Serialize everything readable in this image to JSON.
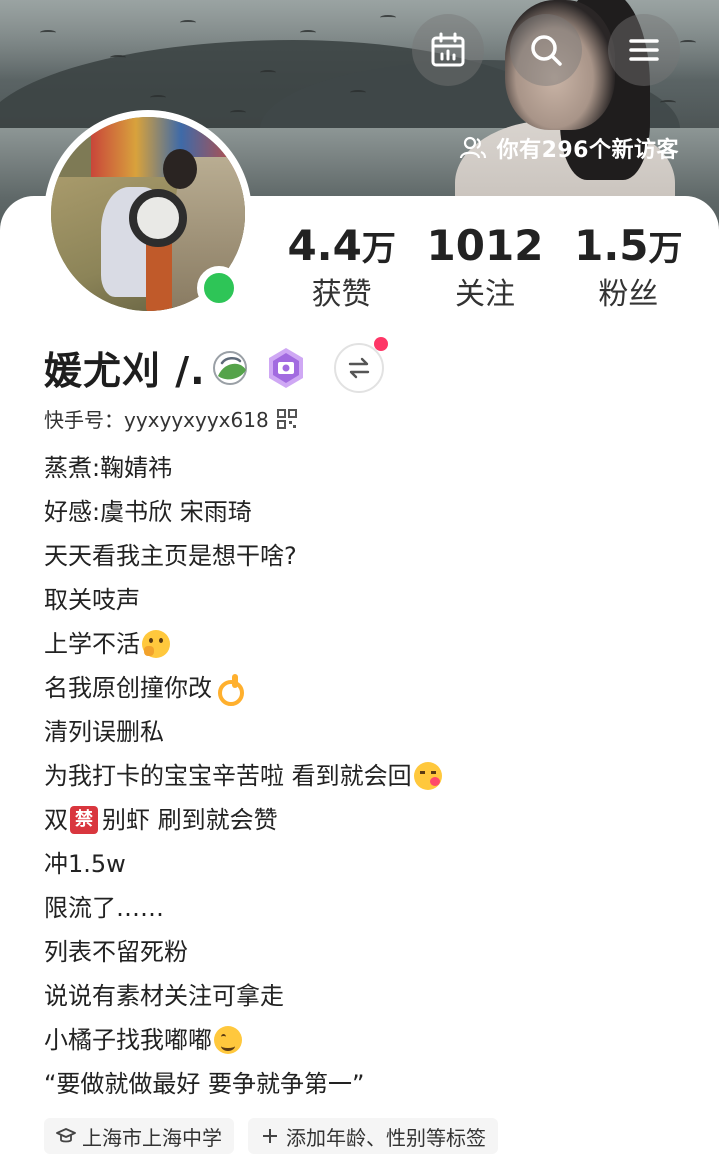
{
  "header": {
    "visitors_text": "你有296个新访客"
  },
  "profile": {
    "name": "媛尤刈 /.",
    "kwai_id": "快手号：yyxyyxyyx618"
  },
  "stats": [
    {
      "number": "4.4",
      "unit": "万",
      "label": "获赞"
    },
    {
      "number": "1012",
      "unit": "",
      "label": "关注"
    },
    {
      "number": "1.5",
      "unit": "万",
      "label": "粉丝"
    }
  ],
  "bio": {
    "l1": "蒸煮:鞠婧祎",
    "l2": "好感:虞书欣 宋雨琦",
    "l3": "天天看我主页是想干啥?",
    "l4": "取关吱声",
    "l5": "上学不活",
    "l6": "名我原创撞你改",
    "l7": "清列误删私",
    "l8": "为我打卡的宝宝辛苦啦 看到就会回",
    "l9a": "双",
    "l9_ban": "禁",
    "l9b": " 别虾 刷到就会赞",
    "l10": "冲1.5w",
    "l11": "限流了……",
    "l12": "列表不留死粉",
    "l13": "说说有素材关注可拿走",
    "l14": "小橘子找我嘟嘟",
    "l15": "“要做就做最好 要争就争第一”"
  },
  "tags": {
    "school": "上海市上海中学",
    "add": "添加年龄、性别等标签"
  },
  "colors": {
    "online": "#2ec557",
    "notify_dot": "#fe3666",
    "ban_red": "#d9363e"
  },
  "icons": [
    "calendar-icon",
    "search-icon",
    "menu-icon",
    "visitors-icon",
    "qr-code-icon",
    "switch-arrows-icon",
    "graduation-cap-icon",
    "plus-icon"
  ]
}
